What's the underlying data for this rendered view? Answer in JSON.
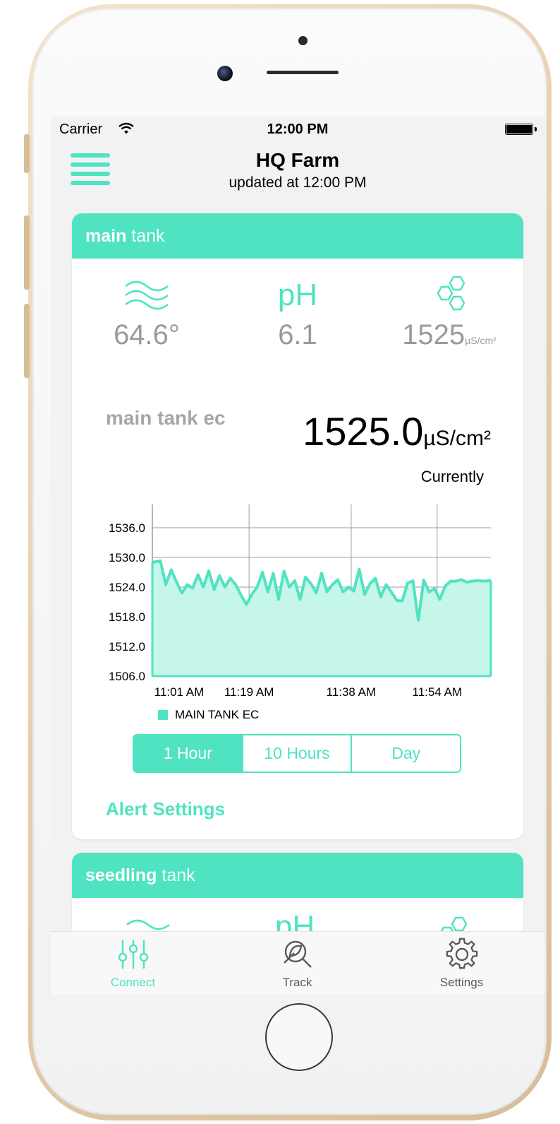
{
  "status_bar": {
    "carrier": "Carrier",
    "time": "12:00 PM"
  },
  "header": {
    "title": "HQ Farm",
    "updated": "updated at 12:00 PM"
  },
  "main_tank": {
    "name_bold": "main",
    "name_rest": " tank",
    "metrics": {
      "temperature": "64.6°",
      "ph_label": "pH",
      "ph": "6.1",
      "ec": "1525",
      "ec_unit": "µS/cm²"
    },
    "ec_title": "main tank ec",
    "ec_current": "1525.0",
    "ec_current_unit": "µS/cm²",
    "currently_label": "Currently",
    "range_buttons": [
      "1 Hour",
      "10 Hours",
      "Day"
    ],
    "range_selected": "1 Hour",
    "alert_settings": "Alert Settings"
  },
  "seedling_tank": {
    "name_bold": "seedling",
    "name_rest": " tank",
    "ph_label": "pH"
  },
  "tab_bar": [
    {
      "label": "Connect",
      "icon": "sliders-icon",
      "active": true
    },
    {
      "label": "Track",
      "icon": "plant-search-icon",
      "active": false
    },
    {
      "label": "Settings",
      "icon": "gear-icon",
      "active": false
    }
  ],
  "colors": {
    "accent": "#4fe3c1",
    "fill": "#c6f5ea",
    "muted_text": "#9a9a9a"
  },
  "chart_data": {
    "type": "area",
    "legend": "MAIN TANK EC",
    "y_ticks": [
      "1536.0",
      "1530.0",
      "1524.0",
      "1518.0",
      "1512.0",
      "1506.0"
    ],
    "ylim": [
      1506,
      1536
    ],
    "x_ticks": [
      {
        "label": "11:01 AM",
        "t": 0
      },
      {
        "label": "11:19 AM",
        "t": 18
      },
      {
        "label": "11:38 AM",
        "t": 37
      },
      {
        "label": "11:54 AM",
        "t": 53
      }
    ],
    "grid": true,
    "series": [
      {
        "name": "MAIN TANK EC",
        "x": [
          0,
          1.5,
          2.5,
          3.5,
          4.5,
          5.5,
          6.5,
          7.5,
          8.5,
          9.5,
          10.5,
          11.5,
          12.5,
          13.5,
          14.5,
          15.5,
          16.5,
          17.5,
          18.5,
          19.5,
          20.5,
          21.5,
          22.5,
          23.5,
          24.5,
          25.5,
          26.5,
          27.5,
          28.5,
          29.5,
          30.5,
          31.5,
          32.5,
          33.5,
          34.5,
          35.5,
          36.5,
          37.5,
          38.5,
          39.5,
          40.5,
          41.5,
          42.5,
          43.5,
          44.5,
          45.5,
          46.5,
          47.5,
          48.5,
          49.5,
          50.5,
          51.5,
          52.5,
          53.5,
          54.5,
          55.5,
          56.5,
          57.5,
          58.5,
          59.5,
          60.5,
          61.5,
          63
        ],
        "y": [
          1529,
          1529.3,
          1524.5,
          1527.5,
          1525,
          1522.8,
          1524.5,
          1523.8,
          1526.5,
          1524,
          1527.3,
          1523.5,
          1526.3,
          1524,
          1525.8,
          1524.5,
          1522.4,
          1520.5,
          1522.5,
          1524,
          1527,
          1523,
          1526.8,
          1521.5,
          1527.2,
          1524,
          1525.3,
          1521.5,
          1526,
          1524.7,
          1522.8,
          1526.8,
          1523,
          1524.5,
          1525.5,
          1523,
          1524,
          1523.2,
          1527.6,
          1522.5,
          1524.7,
          1525.8,
          1522,
          1524.5,
          1523,
          1521.3,
          1521.2,
          1524.8,
          1525.3,
          1517.3,
          1525.4,
          1523,
          1523.7,
          1521.5,
          1524.2,
          1525.2,
          1525.2,
          1525.5,
          1525,
          1525.2,
          1525.3,
          1525.2,
          1525.3
        ]
      }
    ]
  }
}
